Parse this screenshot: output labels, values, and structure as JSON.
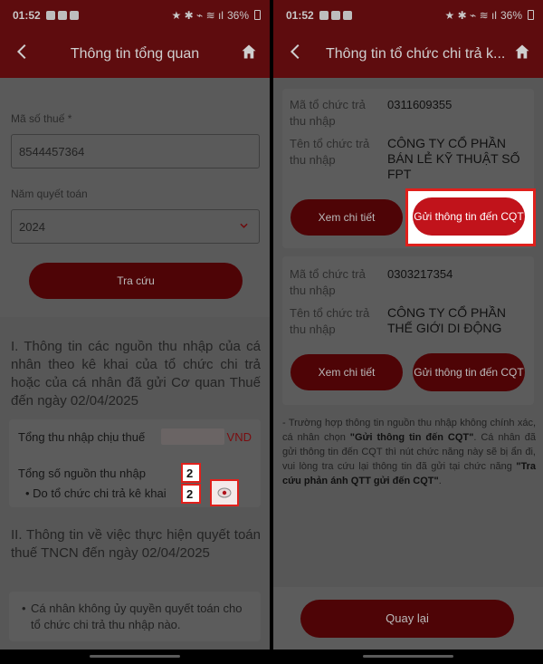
{
  "status": {
    "time": "01:52",
    "battery": "36%"
  },
  "left": {
    "header": {
      "title": "Thông tin tổng quan"
    },
    "tax_code": {
      "label": "Mã số thuế *",
      "value": "8544457364"
    },
    "year": {
      "label": "Năm quyết toán",
      "value": "2024"
    },
    "search_button": "Tra cứu",
    "section1_title": "I. Thông tin các nguồn thu nhập của cá nhân theo kê khai của tổ chức chi trả hoặc của cá nhân đã gửi Cơ quan Thuế đến ngày 02/04/2025",
    "summary": {
      "taxable_income_label": "Tổng thu nhập chịu thuế",
      "taxable_income_currency": "VND",
      "source_count_label": "Tổng số nguồn thu nhập",
      "source_count_value": "2",
      "org_declared_label": "• Do tổ chức chi trả kê khai",
      "org_declared_value": "2"
    },
    "section2_title": "II. Thông tin về việc thực hiện quyết toán thuế TNCN đến ngày 02/04/2025",
    "note": "Cá nhân không ủy quyền quyết toán cho tổ chức chi trả thu nhập nào."
  },
  "right": {
    "header": {
      "title": "Thông tin tổ chức chi trả k..."
    },
    "orgs": [
      {
        "code_label": "Mã tổ chức trả thu nhập",
        "code_value": "0311609355",
        "name_label": "Tên tổ chức trả thu nhập",
        "name_value": "CÔNG TY CỔ PHẦN BÁN LẺ KỸ THUẬT SỐ FPT",
        "detail_button": "Xem chi tiết",
        "send_button": "Gửi thông tin đến CQT"
      },
      {
        "code_label": "Mã tổ chức trả thu nhập",
        "code_value": "0303217354",
        "name_label": "Tên tổ chức trả thu nhập",
        "name_value": "CÔNG TY CỔ PHẦN THẾ GIỚI DI ĐỘNG",
        "detail_button": "Xem chi tiết",
        "send_button": "Gửi thông tin đến CQT"
      }
    ],
    "info_part1": "- Trường hợp thông tin nguồn thu nhập không chính xác, cá nhân chọn ",
    "info_bold1": "\"Gửi thông tin đến CQT\"",
    "info_part2": ". Cá nhân đã gửi thông tin đến CQT thì nút chức năng này sẽ bị ẩn đi, vui lòng tra cứu lại thông tin đã gửi tại chức năng ",
    "info_bold2": "\"Tra cứu phản ánh QTT gửi đến CQT\"",
    "info_part3": ".",
    "back_button": "Quay lại"
  },
  "colors": {
    "header_bg": "#5e0c0e",
    "primary_red": "#c1131b",
    "highlight_border": "#e0201c"
  }
}
